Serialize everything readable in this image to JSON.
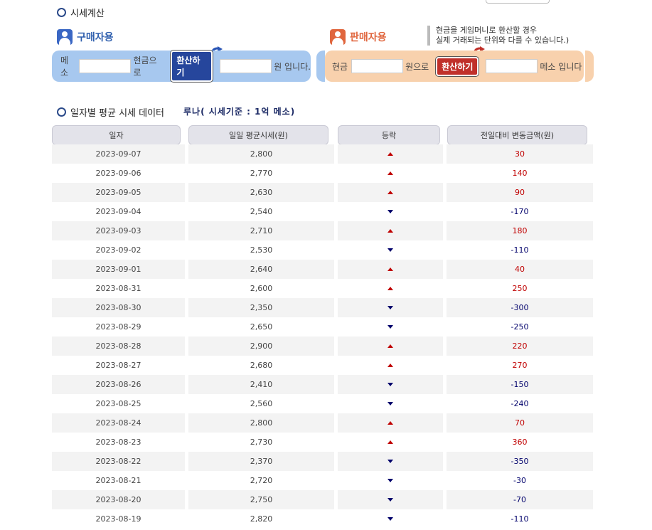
{
  "calc": {
    "title": "시세계산",
    "buy": {
      "title": "구매자용",
      "unit_prefix": "메소",
      "mid_label": "현금으로",
      "button": "환산하기",
      "suffix": "원 입니다."
    },
    "sell": {
      "title": "판매자용",
      "unit_prefix": "현금",
      "mid_label": "원으로",
      "button": "환산하기",
      "suffix": "메소 입니다"
    },
    "notice_line1": "현금을 게임머니로 환산할 경우",
    "notice_line2": "실제 거래되는 단위와 다를 수 있습니다.)"
  },
  "daily": {
    "title": "일자별 평균 시세 데이터",
    "basis": "루나( 시세기준 : 1억 메소)",
    "headers": [
      "일자",
      "일일 평균시세(원)",
      "등락",
      "전일대비 변동금액(원)"
    ],
    "rows": [
      {
        "date": "2023-09-07",
        "price": "2,800",
        "dir": "up",
        "change": "30"
      },
      {
        "date": "2023-09-06",
        "price": "2,770",
        "dir": "up",
        "change": "140"
      },
      {
        "date": "2023-09-05",
        "price": "2,630",
        "dir": "up",
        "change": "90"
      },
      {
        "date": "2023-09-04",
        "price": "2,540",
        "dir": "down",
        "change": "-170"
      },
      {
        "date": "2023-09-03",
        "price": "2,710",
        "dir": "up",
        "change": "180"
      },
      {
        "date": "2023-09-02",
        "price": "2,530",
        "dir": "down",
        "change": "-110"
      },
      {
        "date": "2023-09-01",
        "price": "2,640",
        "dir": "up",
        "change": "40"
      },
      {
        "date": "2023-08-31",
        "price": "2,600",
        "dir": "up",
        "change": "250"
      },
      {
        "date": "2023-08-30",
        "price": "2,350",
        "dir": "down",
        "change": "-300"
      },
      {
        "date": "2023-08-29",
        "price": "2,650",
        "dir": "down",
        "change": "-250"
      },
      {
        "date": "2023-08-28",
        "price": "2,900",
        "dir": "up",
        "change": "220"
      },
      {
        "date": "2023-08-27",
        "price": "2,680",
        "dir": "up",
        "change": "270"
      },
      {
        "date": "2023-08-26",
        "price": "2,410",
        "dir": "down",
        "change": "-150"
      },
      {
        "date": "2023-08-25",
        "price": "2,560",
        "dir": "down",
        "change": "-240"
      },
      {
        "date": "2023-08-24",
        "price": "2,800",
        "dir": "up",
        "change": "70"
      },
      {
        "date": "2023-08-23",
        "price": "2,730",
        "dir": "up",
        "change": "360"
      },
      {
        "date": "2023-08-22",
        "price": "2,370",
        "dir": "down",
        "change": "-350"
      },
      {
        "date": "2023-08-21",
        "price": "2,720",
        "dir": "down",
        "change": "-30"
      },
      {
        "date": "2023-08-20",
        "price": "2,750",
        "dir": "down",
        "change": "-70"
      },
      {
        "date": "2023-08-19",
        "price": "2,820",
        "dir": "down",
        "change": "-110"
      }
    ]
  },
  "colors": {
    "up": "#c00000",
    "down": "#00006b",
    "buy_box": "#a7c8ef",
    "sell_box": "#f8d1ad"
  }
}
